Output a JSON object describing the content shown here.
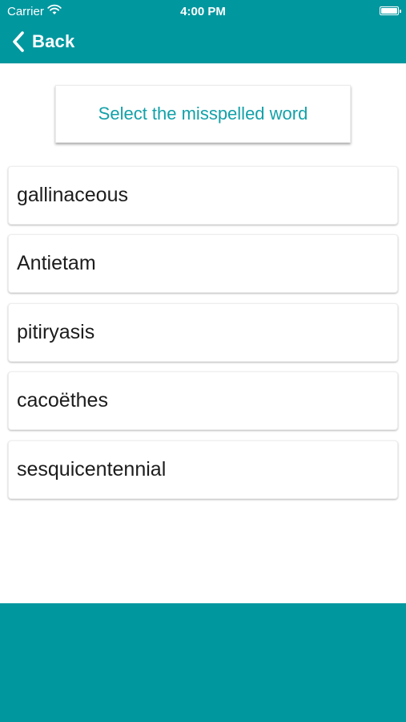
{
  "status_bar": {
    "carrier": "Carrier",
    "time": "4:00 PM",
    "wifi_icon": "wifi-icon",
    "battery_icon": "battery-icon",
    "battery_level": 1.0
  },
  "nav": {
    "back_label": "Back",
    "back_icon": "chevron-left-icon"
  },
  "prompt": {
    "text": "Select the misspelled word"
  },
  "options": [
    {
      "label": "gallinaceous"
    },
    {
      "label": "Antietam"
    },
    {
      "label": "pitiryasis"
    },
    {
      "label": "cacoëthes"
    },
    {
      "label": "sesquicentennial"
    }
  ],
  "colors": {
    "brand": "#00979f",
    "prompt_text": "#13a1a9",
    "option_text": "#1c1c1c",
    "background": "#ffffff"
  }
}
